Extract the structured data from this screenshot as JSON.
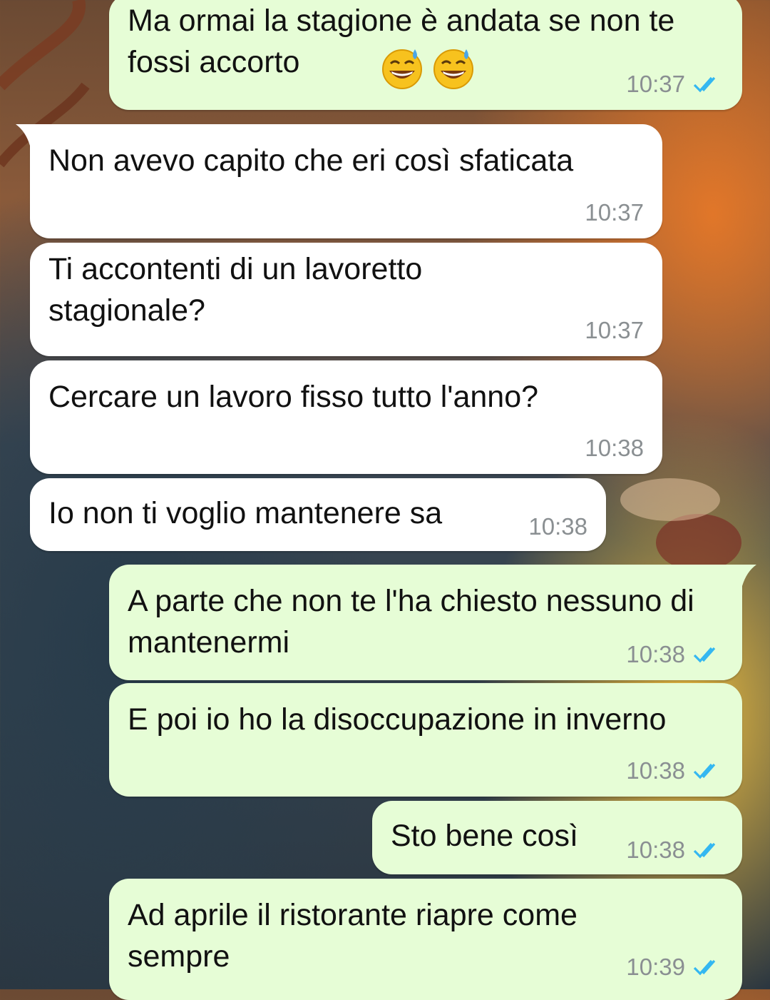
{
  "messages": [
    {
      "dir": "out",
      "text": "Ma ormai la stagione è andata se non te fossi accorto",
      "time": "10:37",
      "emoji": [
        "grinning-sweat-emoji",
        "grinning-sweat-emoji"
      ]
    },
    {
      "dir": "in",
      "text": "Non avevo capito che eri così sfaticata",
      "time": "10:37"
    },
    {
      "dir": "in",
      "text": "Ti accontenti di un lavoretto stagionale?",
      "time": "10:37"
    },
    {
      "dir": "in",
      "text": "Cercare un lavoro fisso tutto l'anno?",
      "time": "10:38"
    },
    {
      "dir": "in",
      "text": "Io non ti voglio mantenere sa",
      "time": "10:38"
    },
    {
      "dir": "out",
      "text": "A parte che non te l'ha chiesto nessuno di mantenermi",
      "time": "10:38"
    },
    {
      "dir": "out",
      "text": "E poi io ho la disoccupazione in inverno",
      "time": "10:38"
    },
    {
      "dir": "out",
      "text": "Sto bene così",
      "time": "10:38"
    },
    {
      "dir": "out",
      "text": "Ad aprile il ristorante riapre come sempre",
      "time": "10:39"
    }
  ],
  "colors": {
    "incoming": "#ffffff",
    "outgoing": "#e6fdd6",
    "read_ticks": "#34b7f1",
    "timestamp": "#8a8f92"
  }
}
